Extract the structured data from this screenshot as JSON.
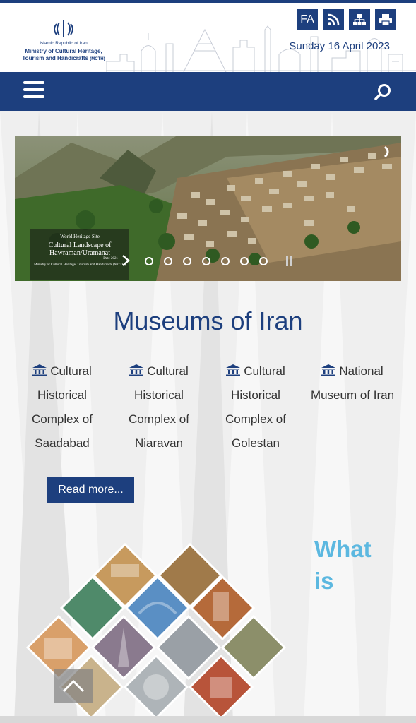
{
  "header": {
    "country": "Islamic Republic of Iran",
    "ministry": "Ministry of Cultural Heritage, Tourism and Handicrafts",
    "ministry_abbr": "(MCTH)",
    "lang_button": "FA",
    "date": "Sunday 16 April 2023",
    "icons": [
      "rss-icon",
      "sitemap-icon",
      "print-icon"
    ]
  },
  "navbar": {
    "menu_icon": "hamburger-menu-icon",
    "search_icon": "search-icon"
  },
  "slider": {
    "caption_small": "World Heritage Site",
    "caption_title": "Cultural Landscape of Hawraman/Uramanat",
    "caption_date": "Date 2021",
    "caption_footer": "Ministry of Cultural Heritage, Tourism and Handicrafts (MCTH)",
    "dots": 7,
    "active_dot": 0
  },
  "museums": {
    "title": "Museums of Iran",
    "items": [
      {
        "label": "Cultural Historical Complex of Saadabad"
      },
      {
        "label": "Cultural Historical Complex of Niaravan"
      },
      {
        "label": "Cultural Historical Complex of Golestan"
      },
      {
        "label": "National Museum of Iran"
      }
    ],
    "read_more": "Read more..."
  },
  "whatis": {
    "line1": "What",
    "line2": "is"
  },
  "colors": {
    "primary": "#1d3f7e",
    "accent": "#5cb8e0",
    "background": "#efefef"
  }
}
